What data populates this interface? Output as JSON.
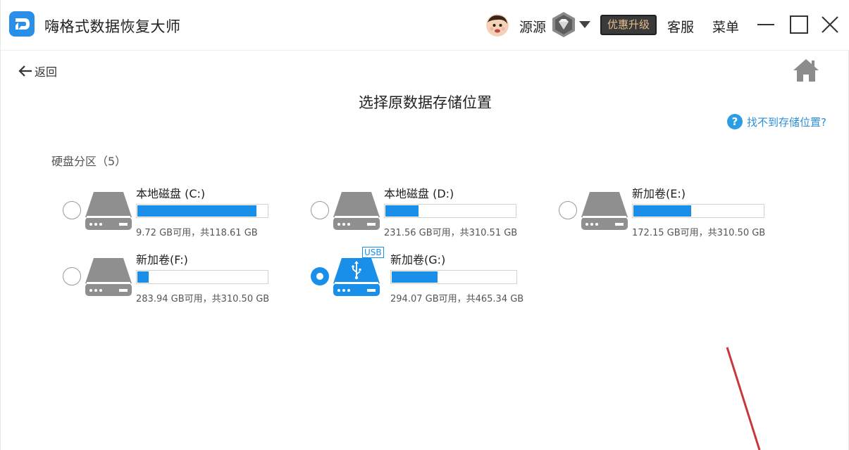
{
  "app": {
    "title": "嗨格式数据恢复大师",
    "username": "源源",
    "upgrade_label": "优惠升级",
    "support_label": "客服",
    "menu_label": "菜单"
  },
  "page": {
    "back_label": "返回",
    "title": "选择原数据存储位置",
    "help_label": "找不到存储位置?",
    "section_label": "硬盘分区（5）"
  },
  "drives": [
    {
      "name": "本地磁盘 (C:)",
      "info": "9.72 GB可用，共118.61 GB",
      "used_fraction": 0.918,
      "selected": false,
      "usb": false
    },
    {
      "name": "本地磁盘 (D:)",
      "info": "231.56 GB可用，共310.51 GB",
      "used_fraction": 0.254,
      "selected": false,
      "usb": false
    },
    {
      "name": "新加卷(E:)",
      "info": "172.15 GB可用，共310.50 GB",
      "used_fraction": 0.446,
      "selected": false,
      "usb": false
    },
    {
      "name": "新加卷(F:)",
      "info": "283.94 GB可用，共310.50 GB",
      "used_fraction": 0.086,
      "selected": false,
      "usb": false
    },
    {
      "name": "新加卷(G:)",
      "info": "294.07 GB可用，共465.34 GB",
      "used_fraction": 0.368,
      "selected": true,
      "usb": true,
      "usb_label": "USB"
    }
  ],
  "colors": {
    "accent": "#1a8fea",
    "drive_gray": "#8f8f8f",
    "upgrade_bg": "#3a3a3a",
    "upgrade_text": "#e7bd8a",
    "help_blue": "#2d9ce6"
  },
  "icons": {
    "logo": "app-logo-icon",
    "vip": "diamond-badge-icon",
    "dropdown": "caret-down-icon",
    "back": "arrow-left-icon",
    "home": "home-icon",
    "help": "question-circle-icon",
    "drive": "hard-drive-icon",
    "usb": "usb-drive-icon"
  }
}
